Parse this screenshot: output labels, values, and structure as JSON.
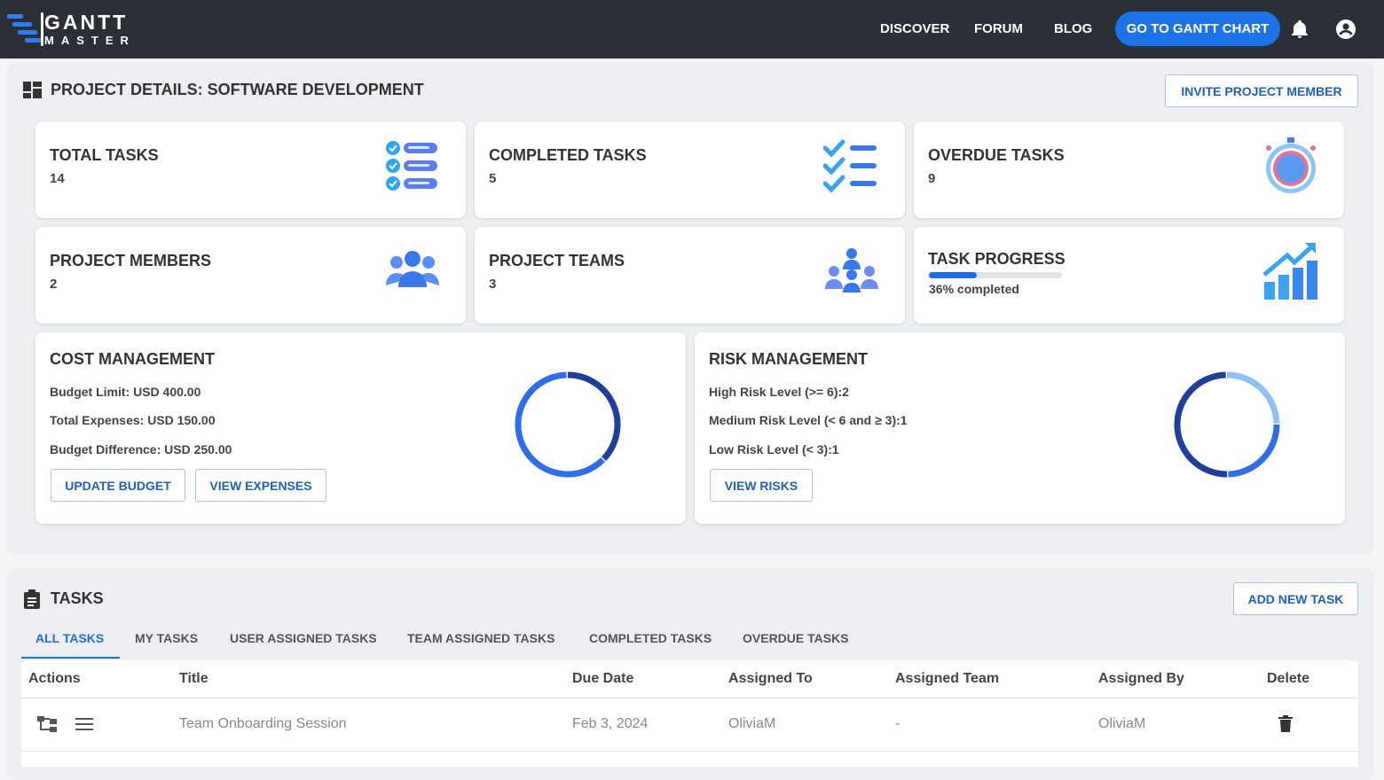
{
  "brand": {
    "line1": "GANTT",
    "line2": "MASTER"
  },
  "nav": {
    "discover": "DISCOVER",
    "forum": "FORUM",
    "blog": "BLOG",
    "cta": "GO TO GANTT CHART"
  },
  "project": {
    "title": "PROJECT DETAILS: SOFTWARE DEVELOPMENT",
    "invite_label": "INVITE PROJECT MEMBER",
    "stats": [
      {
        "label": "TOTAL TASKS",
        "value": "14",
        "icon": "task-list-icon"
      },
      {
        "label": "COMPLETED TASKS",
        "value": "5",
        "icon": "checklist-icon"
      },
      {
        "label": "OVERDUE TASKS",
        "value": "9",
        "icon": "overdue-stopwatch-icon"
      },
      {
        "label": "PROJECT MEMBERS",
        "value": "2",
        "icon": "members-icon"
      },
      {
        "label": "PROJECT TEAMS",
        "value": "3",
        "icon": "teams-icon"
      }
    ],
    "progress": {
      "label": "TASK PROGRESS",
      "text": "36% completed",
      "fraction": 0.36
    }
  },
  "cost": {
    "title": "COST MANAGEMENT",
    "lines": [
      "Budget Limit: USD 400.00",
      "Total Expenses: USD 150.00",
      "Budget Difference: USD 250.00"
    ],
    "update_label": "UPDATE BUDGET",
    "expenses_label": "VIEW EXPENSES",
    "donut": {
      "segments": [
        {
          "value": 150,
          "color": "#1f3f9a"
        },
        {
          "value": 250,
          "color": "#2f6ee8"
        }
      ]
    }
  },
  "risk": {
    "title": "RISK MANAGEMENT",
    "lines": [
      "High Risk Level (>= 6):2",
      "Medium Risk Level (< 6 and ≥ 3):1",
      "Low Risk Level (< 3):1"
    ],
    "view_label": "VIEW RISKS",
    "donut": {
      "segments": [
        {
          "value": 1,
          "color": "#8fc1f5"
        },
        {
          "value": 1,
          "color": "#2f6ee8"
        },
        {
          "value": 2,
          "color": "#1f3f9a"
        }
      ]
    }
  },
  "tasks": {
    "title": "TASKS",
    "add_label": "ADD NEW TASK",
    "tabs": [
      "ALL TASKS",
      "MY TASKS",
      "USER ASSIGNED TASKS",
      "TEAM ASSIGNED TASKS",
      "COMPLETED TASKS",
      "OVERDUE TASKS"
    ],
    "columns": [
      "Actions",
      "Title",
      "Due Date",
      "Assigned To",
      "Assigned Team",
      "Assigned By",
      "Delete"
    ],
    "rows": [
      {
        "title": "Team Onboarding Session",
        "due": "Feb 3, 2024",
        "assigned_to": "OliviaM",
        "team": "-",
        "assigned_by": "OliviaM"
      }
    ]
  },
  "colors": {
    "topbar": "#2b2f36",
    "accent": "#1d72e8",
    "link": "#1f5fbf"
  }
}
